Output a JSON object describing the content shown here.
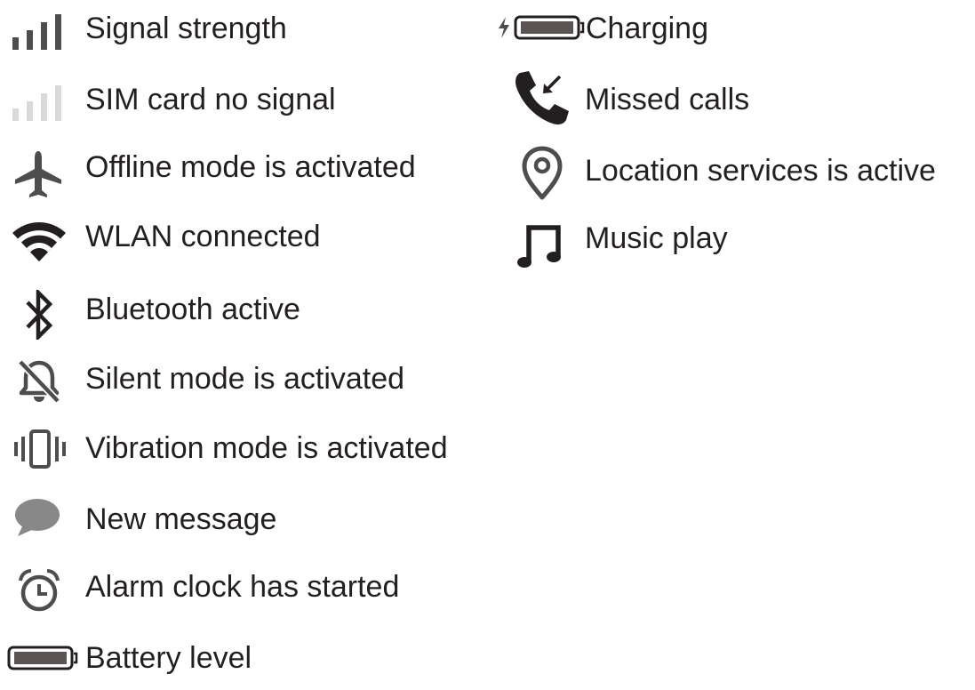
{
  "colors": {
    "text": "#231f20",
    "icon_dark": "#231f20",
    "icon_gray": "#4d4d4d",
    "icon_light": "#d9d9d9",
    "battery_fill": "#5a5452",
    "message_bubble": "#888888"
  },
  "left_column": [
    {
      "icon": "signal-strength-icon",
      "label": "Signal strength"
    },
    {
      "icon": "sim-no-signal-icon",
      "label": "SIM card no signal"
    },
    {
      "icon": "airplane-icon",
      "label": "Offline mode is activated"
    },
    {
      "icon": "wifi-icon",
      "label": "WLAN connected"
    },
    {
      "icon": "bluetooth-icon",
      "label": "Bluetooth active"
    },
    {
      "icon": "bell-off-icon",
      "label": "Silent mode is activated"
    },
    {
      "icon": "vibration-icon",
      "label": "Vibration mode is activated"
    },
    {
      "icon": "message-bubble-icon",
      "label": "New message"
    },
    {
      "icon": "alarm-clock-icon",
      "label": "Alarm clock has started"
    },
    {
      "icon": "battery-icon",
      "label": "Battery level"
    }
  ],
  "right_column": [
    {
      "icon": "battery-charging-icon",
      "label": "Charging"
    },
    {
      "icon": "missed-call-icon",
      "label": "Missed calls"
    },
    {
      "icon": "location-pin-icon",
      "label": "Location services is active"
    },
    {
      "icon": "music-note-icon",
      "label": "Music play"
    }
  ]
}
